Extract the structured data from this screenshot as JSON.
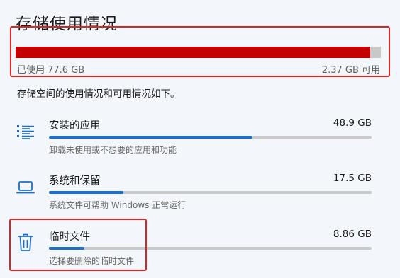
{
  "page": {
    "title": "存储使用情况"
  },
  "summary": {
    "used_label": "已使用 77.6 GB",
    "free_label": "2.37 GB 可用",
    "used_fraction": 0.97,
    "fill_color": "#c40000",
    "track_color": "#c8c8c8"
  },
  "description": "存储空间的使用情况和可用情况如下。",
  "categories": [
    {
      "icon": "apps-list-icon",
      "name": "安装的应用",
      "size": "48.9 GB",
      "subtitle": "卸载未使用或不想要的应用和功能",
      "usage_fraction": 0.63
    },
    {
      "icon": "laptop-icon",
      "name": "系统和保留",
      "size": "17.5 GB",
      "subtitle": "系统文件可帮助 Windows 正常运行",
      "usage_fraction": 0.23
    },
    {
      "icon": "trash-icon",
      "name": "临时文件",
      "size": "8.86 GB",
      "subtitle": "选择要删除的临时文件",
      "usage_fraction": 0.11
    }
  ],
  "colors": {
    "accent": "#1d6fc7",
    "highlight_border": "#e02222"
  }
}
